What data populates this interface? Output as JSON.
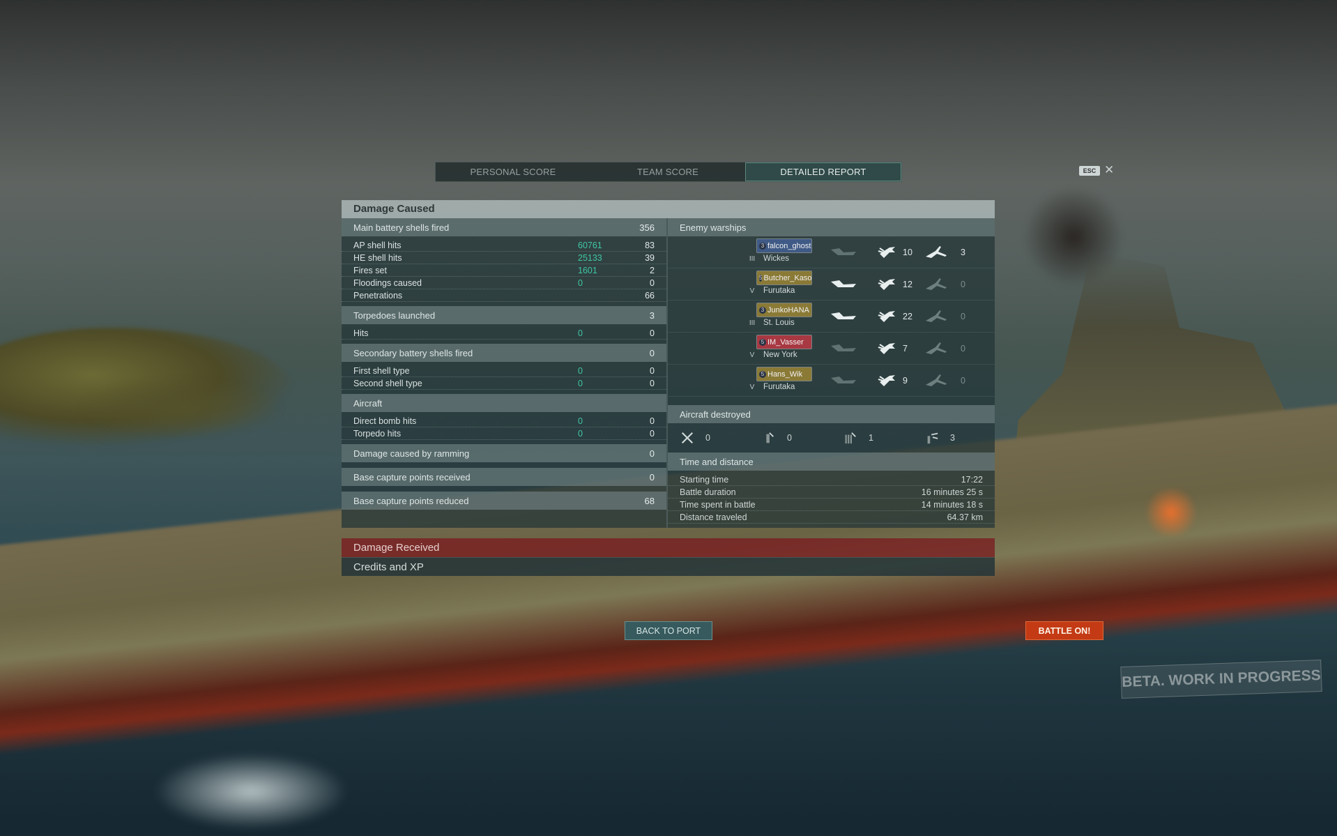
{
  "tabs": [
    "PERSONAL SCORE",
    "TEAM SCORE",
    "DETAILED REPORT"
  ],
  "esc_label": "ESC",
  "close_glyph": "✕",
  "damage_caused": {
    "title": "Damage Caused",
    "main_battery": {
      "label": "Main battery shells fired",
      "value": "356",
      "rows": [
        {
          "label": "AP shell hits",
          "green": "60761",
          "value": "83"
        },
        {
          "label": "HE shell hits",
          "green": "25133",
          "value": "39"
        },
        {
          "label": "Fires set",
          "green": "1601",
          "value": "2"
        },
        {
          "label": "Floodings caused",
          "green": "0",
          "value": "0"
        },
        {
          "label": "Penetrations",
          "green": "",
          "value": "66"
        }
      ]
    },
    "torpedoes": {
      "label": "Torpedoes launched",
      "value": "3",
      "rows": [
        {
          "label": "Hits",
          "green": "0",
          "value": "0"
        }
      ]
    },
    "secondary": {
      "label": "Secondary battery shells fired",
      "value": "0",
      "rows": [
        {
          "label": "First shell type",
          "green": "0",
          "value": "0"
        },
        {
          "label": "Second shell type",
          "green": "0",
          "value": "0"
        }
      ]
    },
    "aircraft": {
      "label": "Aircraft",
      "value": "",
      "rows": [
        {
          "label": "Direct bomb hits",
          "green": "0",
          "value": "0"
        },
        {
          "label": "Torpedo hits",
          "green": "0",
          "value": "0"
        }
      ]
    },
    "ramming": {
      "label": "Damage caused by ramming",
      "value": "0"
    },
    "capture_received": {
      "label": "Base capture points received",
      "value": "0"
    },
    "capture_reduced": {
      "label": "Base capture points reduced",
      "value": "68"
    }
  },
  "enemy_warships": {
    "label": "Enemy warships",
    "ships": [
      {
        "player": "falcon_ghost",
        "level": "3",
        "tier": "III",
        "name": "Wickes",
        "plate": "#3f5a86",
        "kill": false,
        "hits": "10",
        "planes": "3",
        "planes_active": true
      },
      {
        "player": "Butcher_Kaso",
        "level": "5",
        "tier": "V",
        "name": "Furutaka",
        "plate": "#8a7a36",
        "kill": true,
        "hits": "12",
        "planes": "0",
        "planes_active": false
      },
      {
        "player": "JunkoHANA",
        "level": "3",
        "tier": "III",
        "name": "St. Louis",
        "plate": "#8a7a36",
        "kill": true,
        "hits": "22",
        "planes": "0",
        "planes_active": false
      },
      {
        "player": "IM_Vasser",
        "level": "5",
        "tier": "V",
        "name": "New York",
        "plate": "#a83842",
        "kill": false,
        "hits": "7",
        "planes": "0",
        "planes_active": false
      },
      {
        "player": "Hans_Wik",
        "level": "5",
        "tier": "V",
        "name": "Furutaka",
        "plate": "#8a7a36",
        "kill": false,
        "hits": "9",
        "planes": "0",
        "planes_active": false
      }
    ]
  },
  "aircraft_destroyed": {
    "label": "Aircraft destroyed",
    "items": [
      {
        "icon": "fighter-icon",
        "value": "0"
      },
      {
        "icon": "bomber-icon",
        "value": "0"
      },
      {
        "icon": "torpedo-bomber-icon",
        "value": "1"
      },
      {
        "icon": "scout-plane-icon",
        "value": "3"
      }
    ]
  },
  "time_distance": {
    "label": "Time and distance",
    "rows": [
      {
        "label": "Starting time",
        "value": "17:22"
      },
      {
        "label": "Battle duration",
        "value": "16 minutes 25 s"
      },
      {
        "label": "Time spent in battle",
        "value": "14 minutes 18 s"
      },
      {
        "label": "Distance traveled",
        "value": "64.37 km"
      }
    ]
  },
  "damage_received": "Damage Received",
  "credits_xp": "Credits and XP",
  "back_to_port": "BACK TO PORT",
  "battle_on": "BATTLE ON!",
  "beta": "BETA. WORK IN PROGRESS"
}
